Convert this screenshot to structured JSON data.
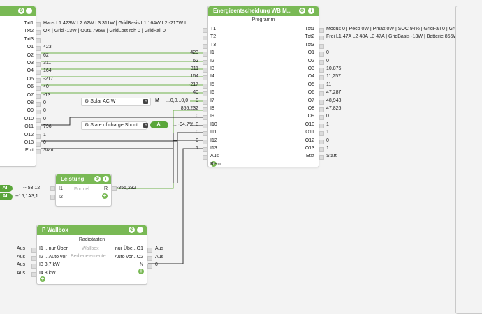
{
  "colors": {
    "header_green": "#79b955",
    "line_green": "#5aa63a",
    "line_dark": "#333333"
  },
  "left_block": {
    "header_icons": [
      "settings-icon",
      "info-icon"
    ],
    "rows": [
      {
        "port": "Txt1",
        "value": "Haus L1 423W L2 62W L3 311W | GridBasis L1 164W L2 -217W L..."
      },
      {
        "port": "Txt2",
        "value": "OK | Grid -13W | Out1 796W | GridLost roh 0 | GridFail 0"
      },
      {
        "port": "Txt3",
        "value": ""
      },
      {
        "port": "O1",
        "value": "423"
      },
      {
        "port": "O2",
        "value": "62"
      },
      {
        "port": "O3",
        "value": "311"
      },
      {
        "port": "O4",
        "value": "164"
      },
      {
        "port": "O5",
        "value": "-217"
      },
      {
        "port": "O6",
        "value": "40"
      },
      {
        "port": "O7",
        "value": "-13"
      },
      {
        "port": "O8",
        "value": "0"
      },
      {
        "port": "O9",
        "value": "0"
      },
      {
        "port": "O10",
        "value": "0"
      },
      {
        "port": "O11",
        "value": "796"
      },
      {
        "port": "O12",
        "value": "1"
      },
      {
        "port": "O13",
        "value": "0"
      },
      {
        "port": "Etxt",
        "value": "Start"
      }
    ]
  },
  "energy_block": {
    "title": "Energieentscheidung  WB  M...",
    "subtitle": "Programm",
    "left_ports": [
      {
        "port": "T1",
        "value": ""
      },
      {
        "port": "T2",
        "value": ""
      },
      {
        "port": "T3",
        "value": ""
      },
      {
        "port": "I1",
        "value": "423"
      },
      {
        "port": "I2",
        "value": "62"
      },
      {
        "port": "I3",
        "value": "311"
      },
      {
        "port": "I4",
        "value": "164"
      },
      {
        "port": "I5",
        "value": "-217"
      },
      {
        "port": "I6",
        "value": "40"
      },
      {
        "port": "I7",
        "value": "0"
      },
      {
        "port": "I8",
        "value": "855,232"
      },
      {
        "port": "I9",
        "value": "0"
      },
      {
        "port": "I10",
        "value": "0"
      },
      {
        "port": "I11",
        "value": "0"
      },
      {
        "port": "I12",
        "value": "0"
      },
      {
        "port": "I13",
        "value": "1"
      },
      {
        "port": "Aus",
        "value": ""
      }
    ],
    "rem_label": "Rem",
    "right_ports": [
      {
        "port": "Txt1",
        "value": "Modus 0 | Peco 0W | Pmax 0W | SOC 94% | GridFail 0 | Grund 1"
      },
      {
        "port": "Txt2",
        "value": "Frei L1 47A L2 48A L3 47A | GridBasis -13W | Batterie 855W | WB"
      },
      {
        "port": "Txt3",
        "value": ""
      },
      {
        "port": "O1",
        "value": "0"
      },
      {
        "port": "O2",
        "value": "0"
      },
      {
        "port": "O3",
        "value": "10,876"
      },
      {
        "port": "O4",
        "value": "11,257"
      },
      {
        "port": "O5",
        "value": "11"
      },
      {
        "port": "O6",
        "value": "47,287"
      },
      {
        "port": "O7",
        "value": "48,943"
      },
      {
        "port": "O8",
        "value": "47,826"
      },
      {
        "port": "O9",
        "value": "0"
      },
      {
        "port": "O10",
        "value": "1"
      },
      {
        "port": "O11",
        "value": "1"
      },
      {
        "port": "O12",
        "value": "0"
      },
      {
        "port": "O13",
        "value": "1"
      },
      {
        "port": "Etxt",
        "value": "Start"
      }
    ]
  },
  "solar": {
    "label": "Solar AC W",
    "tag": "M",
    "value": "0,0"
  },
  "charge": {
    "label": "State of charge Shunt",
    "pill": "AI",
    "value": "94,7%",
    "dots": "..."
  },
  "leistung": {
    "title": "Leistung",
    "i1": "I1",
    "i2": "I2",
    "r": "R",
    "center": "Formel",
    "in1_value": "53,12",
    "in2_value": "-16,1A3,1",
    "out_value": "855,232",
    "pill": "AI"
  },
  "wallbox": {
    "title": "P Wallbox",
    "subtitle": "Radiotasten",
    "center1": "Wallbox",
    "center2": "Bedienelemente",
    "left": [
      {
        "label": "Aus",
        "port": "I1",
        "val": "...nur Über"
      },
      {
        "label": "Aus",
        "port": "I2",
        "val": "...Auto vor"
      },
      {
        "label": "Aus",
        "port": "I3",
        "val": "3,7 kW"
      },
      {
        "label": "Aus",
        "port": "I4",
        "val": "8 kW"
      }
    ],
    "right": [
      {
        "val": "nur Übe...",
        "port": "O1",
        "label": "Aus"
      },
      {
        "val": "Auto vor...",
        "port": "O2",
        "label": "Aus"
      },
      {
        "val": "",
        "port": "N",
        "label": "0"
      }
    ]
  }
}
